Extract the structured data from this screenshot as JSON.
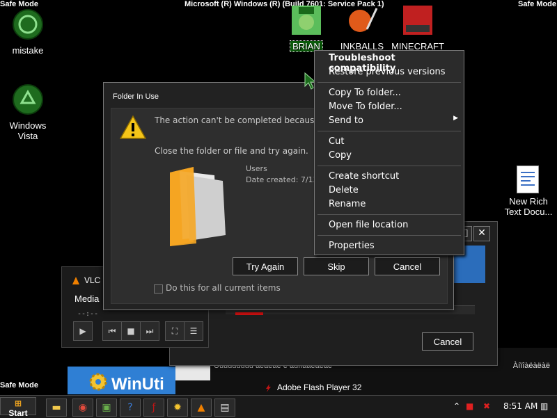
{
  "overlay": {
    "safe_mode": "Safe Mode",
    "build": "Microsoft (R) Windows (R) (Build 7601: Service Pack 1)"
  },
  "desktop_icons": {
    "mistake": "mistake",
    "vista": "Windows Vista",
    "brian": "BRIAN",
    "inkballs": "INKBALLS",
    "minecraft": "MINECRAFT",
    "rtf": "New Rich Text Docu..."
  },
  "folder_dialog": {
    "title": "Folder In Use",
    "message": "The action can't be completed because the another program",
    "instruction": "Close the folder or file and try again.",
    "item_name": "Users",
    "item_date": "Date created: 7/13/",
    "try_again": "Try Again",
    "skip": "Skip",
    "cancel": "Cancel",
    "do_this": "Do this for all current items"
  },
  "context_menu": {
    "troubleshoot": "Troubleshoot compatibility",
    "restore": "Restore previous versions",
    "copy_to": "Copy To folder...",
    "move_to": "Move To folder...",
    "send_to": "Send to",
    "cut": "Cut",
    "copy": "Copy",
    "create_shortcut": "Create shortcut",
    "delete": "Delete",
    "rename": "Rename",
    "open_location": "Open file location",
    "properties": "Properties",
    "arrow": "▶"
  },
  "back_window": {
    "cancel": "Cancel",
    "close": "✕",
    "restore": "□"
  },
  "vlc": {
    "title": "VLC",
    "menu": "Media",
    "time": "--:--"
  },
  "winuti": "WinUti",
  "strip": {
    "text1": "Ùüüüüüüüü àëàëàë ë àüîîâàëàëàë",
    "text2": "Àíïîàëàëàë",
    "flash": "Adobe Flash Player 32"
  },
  "taskbar": {
    "start": "Start",
    "clock": "8:51 AM"
  },
  "colors": {
    "desktop": "#000000",
    "selection": "#0a5a0a",
    "accent_blue": "#2b6dbb"
  }
}
